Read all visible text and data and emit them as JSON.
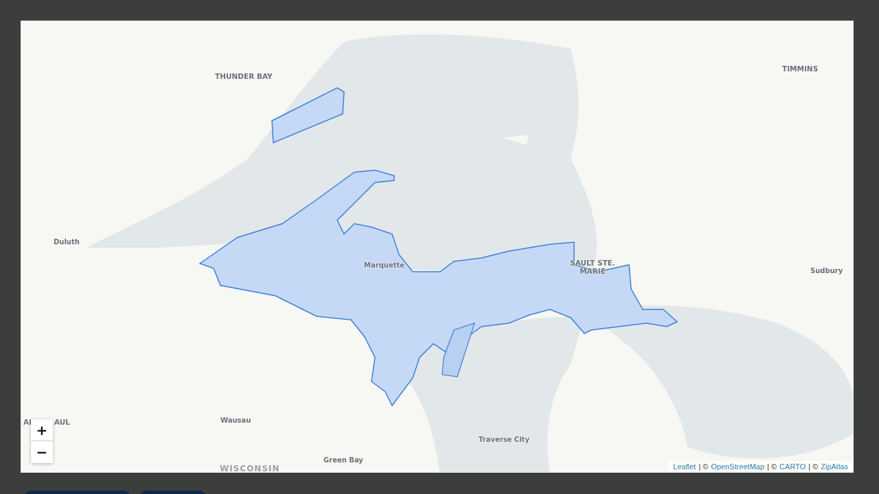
{
  "map": {
    "labels": [
      {
        "text": "THUNDER BAY",
        "kind": "major"
      },
      {
        "text": "TIMMINS",
        "kind": "major"
      },
      {
        "text": "Duluth",
        "kind": "minor"
      },
      {
        "text": "Marquette",
        "kind": "minor"
      },
      {
        "text": "SAULT STE. MARIE",
        "kind": "major"
      },
      {
        "text": "Sudbury",
        "kind": "minor"
      },
      {
        "text": "Al",
        "kind": "fragment"
      },
      {
        "text": "AUL",
        "kind": "fragment"
      },
      {
        "text": "Wausau",
        "kind": "minor"
      },
      {
        "text": "Traverse City",
        "kind": "minor"
      },
      {
        "text": "Green Bay",
        "kind": "minor"
      },
      {
        "text": "WISCONSIN",
        "kind": "region"
      }
    ],
    "zoom_controls": [
      "+",
      "−"
    ],
    "attribution": [
      {
        "kind": "link",
        "text": "Leaflet"
      },
      {
        "kind": "plain",
        "text": "| ©"
      },
      {
        "kind": "link",
        "text": "OpenStreetMap"
      },
      {
        "kind": "plain",
        "text": "| ©"
      },
      {
        "kind": "link",
        "text": "CARTO"
      },
      {
        "kind": "plain",
        "text": "| ©"
      },
      {
        "kind": "link",
        "text": "ZipAtlas"
      }
    ]
  }
}
